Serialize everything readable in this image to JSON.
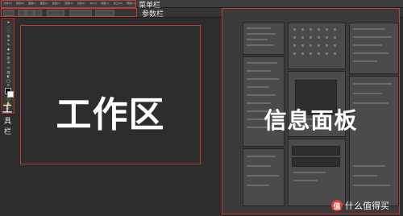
{
  "menubar": {
    "label": "菜单栏",
    "items": [
      "文件(F)",
      "编辑(E)",
      "图像(I)",
      "图层(L)",
      "类型(Y)",
      "选择(S)",
      "滤镜(T)",
      "3D(D)",
      "视图(V)",
      "窗口(W)",
      "帮助(H)"
    ]
  },
  "optionsbar": {
    "label": "参数栏"
  },
  "toolbox": {
    "label_chars": [
      "工",
      "具",
      "栏"
    ],
    "tools": [
      "move-tool-icon",
      "marquee-tool-icon",
      "lasso-tool-icon",
      "quick-select-tool-icon",
      "crop-tool-icon",
      "eyedropper-tool-icon",
      "healing-brush-tool-icon",
      "brush-tool-icon",
      "clone-stamp-tool-icon",
      "history-brush-tool-icon",
      "eraser-tool-icon",
      "gradient-tool-icon",
      "blur-tool-icon",
      "dodge-tool-icon",
      "pen-tool-icon",
      "type-tool-icon",
      "path-select-tool-icon",
      "shape-tool-icon",
      "hand-tool-icon",
      "zoom-tool-icon"
    ]
  },
  "workspace": {
    "label": "工作区"
  },
  "panels": {
    "label": "信息面板"
  },
  "watermark": {
    "text": "什么值得买",
    "icon": "值"
  },
  "colors": {
    "highlight_border": "#c23a36",
    "ui_background": "#2d2d2d",
    "annotation_text": "#ffffff"
  }
}
